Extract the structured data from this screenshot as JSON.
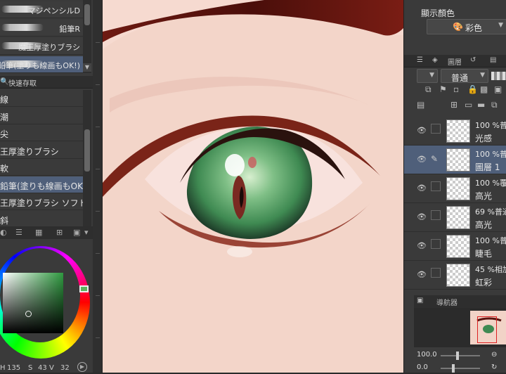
{
  "brushes": [
    {
      "name": "マジペンシルD",
      "selected": false
    },
    {
      "name": "鉛筆R",
      "selected": false
    },
    {
      "name": "魔王厚塗りブラシ",
      "selected": false
    },
    {
      "name": "色鉛筆(塗りも線画もOK!)",
      "selected": true
    }
  ],
  "quick_access": {
    "tab_label": "快速存取",
    "items": [
      {
        "name": "線",
        "selected": false
      },
      {
        "name": "潮",
        "selected": false
      },
      {
        "name": "尖",
        "selected": false
      },
      {
        "name": "王厚塗りブラシ",
        "selected": false
      },
      {
        "name": "軟",
        "selected": false
      },
      {
        "name": "鉛筆(塗りも線画もOK!)",
        "selected": true
      },
      {
        "name": "王厚塗りブラシ ソフト",
        "selected": false
      },
      {
        "name": "斜",
        "selected": false
      }
    ]
  },
  "color": {
    "readout": {
      "h": "135",
      "s_label": "S",
      "s": "43",
      "v_label": "V",
      "v": "32"
    },
    "accent": "#2f9a40"
  },
  "right_panel": {
    "display_color_title": "顯示顏色",
    "color_mode": "彩色",
    "layer_tab": "圖層",
    "blend_mode": "普通",
    "layers": [
      {
        "opacity_mode": "100 %普",
        "name": "光感",
        "selected": false,
        "pencil": false
      },
      {
        "opacity_mode": "100 %普",
        "name": "圖層 1",
        "selected": true,
        "pencil": true
      },
      {
        "opacity_mode": "100 %覆",
        "name": "高光",
        "selected": false,
        "pencil": false
      },
      {
        "opacity_mode": "69 %普通",
        "name": "高光",
        "selected": false,
        "pencil": false
      },
      {
        "opacity_mode": "100 %普",
        "name": "睫毛",
        "selected": false,
        "pencil": false
      },
      {
        "opacity_mode": "45 %相加",
        "name": "虹彩",
        "selected": false,
        "pencil": false
      }
    ],
    "navigator_tab": "導航器",
    "zoom_value": "100.0",
    "rotate_value": "0.0"
  }
}
